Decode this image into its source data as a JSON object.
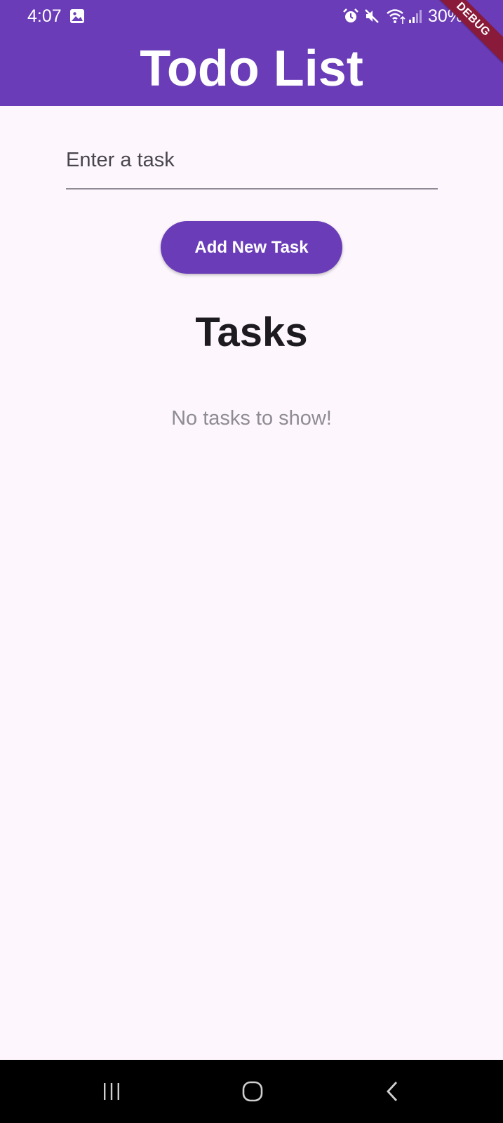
{
  "status_bar": {
    "time": "4:07",
    "battery": "30%"
  },
  "app_bar": {
    "title": "Todo List",
    "color": "#6a3cb8"
  },
  "debug_banner": "DEBUG",
  "input": {
    "placeholder": "Enter a task",
    "value": ""
  },
  "add_button": {
    "label": "Add New Task"
  },
  "tasks_section": {
    "title": "Tasks",
    "empty_message": "No tasks to show!"
  },
  "icons": {
    "status": [
      "gallery-icon",
      "alarm-icon",
      "mute-icon",
      "wifi-icon",
      "signal-icon"
    ],
    "nav": [
      "recent-apps-icon",
      "home-icon",
      "back-icon"
    ]
  }
}
